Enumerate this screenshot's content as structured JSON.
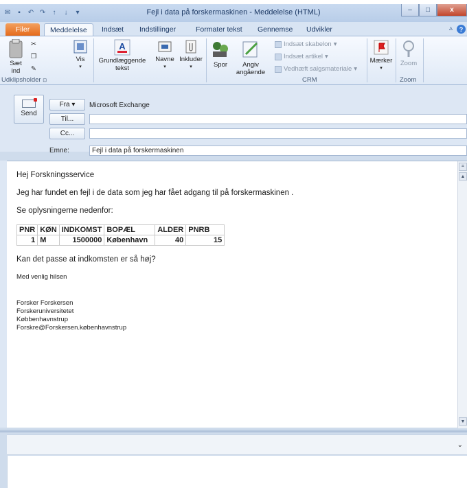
{
  "window": {
    "title": "Fejl i data på forskermaskinen - Meddelelse (HTML)",
    "controls": {
      "minimize": "–",
      "maximize": "□",
      "close": "x"
    }
  },
  "tabs": [
    {
      "label": "Filer"
    },
    {
      "label": "Meddelelse"
    },
    {
      "label": "Indsæt"
    },
    {
      "label": "Indstillinger"
    },
    {
      "label": "Formater tekst"
    },
    {
      "label": "Gennemse"
    },
    {
      "label": "Udvikler"
    }
  ],
  "ribbon": {
    "paste_label": "Sæt\nind",
    "vis_label": "Vis",
    "basic_text_label": "Grundlæggende\ntekst",
    "names_label": "Navne",
    "include_label": "Inkluder",
    "track_label": "Spor",
    "specify_label": "Angiv\nangående",
    "insert_template": "Indsæt skabelon",
    "insert_article": "Indsæt artikel",
    "attach_sales": "Vedhæft salgsmateriale",
    "tags_label": "Mærker",
    "zoom_label": "Zoom",
    "groups": {
      "clipboard": "Udklipsholder",
      "crm": "CRM",
      "zoom": "Zoom"
    }
  },
  "header": {
    "send_label": "Send",
    "from_label": "Fra",
    "from_value": "Microsoft Exchange",
    "to_label": "Til...",
    "cc_label": "Cc...",
    "subject_label": "Emne:",
    "subject_value": "Fejl i data på forskermaskinen"
  },
  "body": {
    "greeting": "Hej Forskningsservice",
    "line1": "Jeg har fundet en fejl i de data som jeg har fået adgang til på forskermaskinen .",
    "line2": "Se oplysningerne nedenfor:",
    "table": {
      "headers": [
        "PNR",
        "KØN",
        "INDKOMST",
        "BOPÆL",
        "ALDER",
        "PNRB"
      ],
      "row": [
        "1",
        "M",
        "1500000",
        "København",
        "40",
        "15"
      ]
    },
    "question": "Kan det passe at indkomsten er så høj?",
    "closing": "Med venlig hilsen",
    "signature": [
      "Forsker Forskersen",
      "Forskeruniversitetet",
      "Købbenhavnstrup",
      "Forskre@Forskersen.københavnstrup"
    ]
  }
}
